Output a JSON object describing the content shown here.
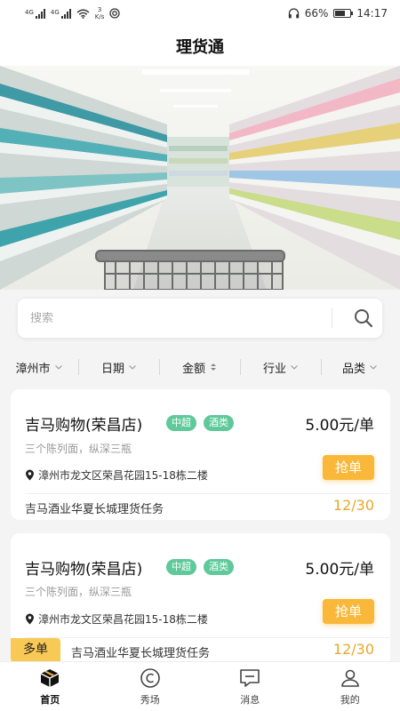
{
  "status_bar": {
    "signal1_label": "4G",
    "signal2_label": "4G",
    "speed_value": "3",
    "speed_unit": "K/s",
    "battery": "66%",
    "battery_level": 0.66,
    "time": "14:17"
  },
  "app_title": "理货通",
  "search": {
    "placeholder": "搜索"
  },
  "filters": [
    {
      "label": "漳州市"
    },
    {
      "label": "日期"
    },
    {
      "label": "金额"
    },
    {
      "label": "行业"
    },
    {
      "label": "品类"
    }
  ],
  "tasks": [
    {
      "store": "吉马购物(荣昌店)",
      "tags": [
        "中超",
        "酒类"
      ],
      "price": "5.00元/单",
      "description": "三个陈列面，纵深三瓶",
      "address": "漳州市龙文区荣昌花园15-18栋二楼",
      "grab_label": "抢单",
      "task_name": "吉马酒业华夏长城理货任务",
      "count": "12/30"
    },
    {
      "store": "吉马购物(荣昌店)",
      "tags": [
        "中超",
        "酒类"
      ],
      "price": "5.00元/单",
      "description": "三个陈列面，纵深三瓶",
      "address": "漳州市龙文区荣昌花园15-18栋二楼",
      "grab_label": "抢单",
      "task_name": "吉马酒业华夏长城理货任务",
      "count": "12/30",
      "badge": "多单"
    }
  ],
  "tabbar": [
    {
      "label": "首页",
      "icon": "home-box-icon",
      "active": true
    },
    {
      "label": "秀场",
      "icon": "show-icon",
      "active": false
    },
    {
      "label": "消息",
      "icon": "message-icon",
      "active": false
    },
    {
      "label": "我的",
      "icon": "profile-icon",
      "active": false
    }
  ],
  "colors": {
    "tag_green": "#5fc99a",
    "grab_orange": "#f9b83a",
    "count_orange": "#e8a72a",
    "badge_yellow": "#f9c955"
  }
}
